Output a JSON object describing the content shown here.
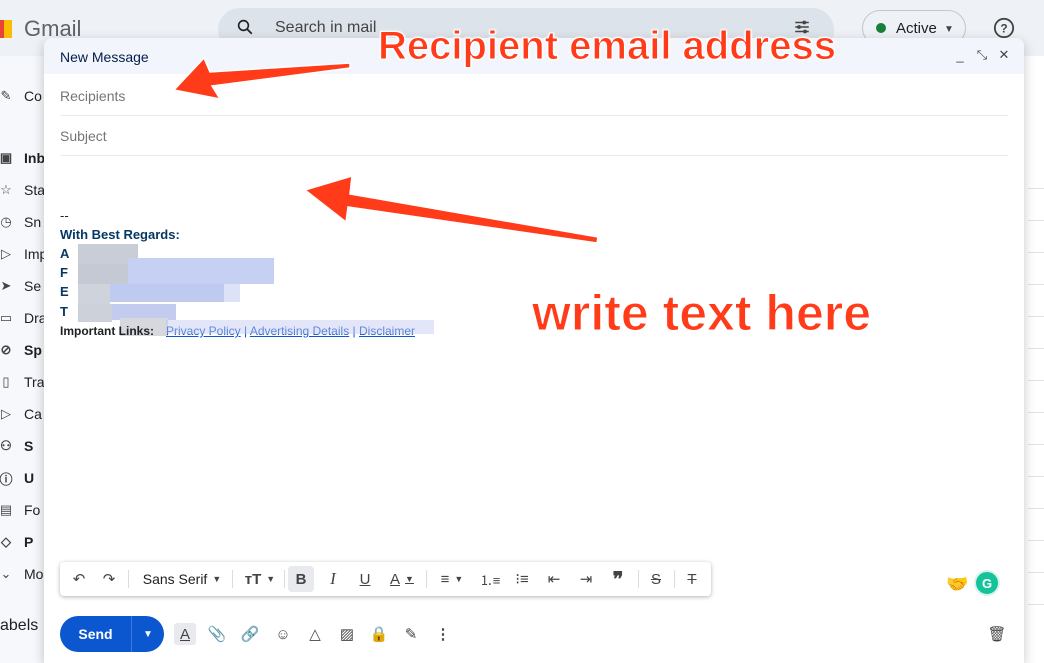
{
  "app": {
    "logo_text": "Gmail",
    "search_placeholder": "Search in mail",
    "status_label": "Active",
    "labels_heading": "abels"
  },
  "sidebar": {
    "items": [
      {
        "label": "Co",
        "icon": "pencil-icon"
      },
      {
        "label": "Inb",
        "icon": "inbox-icon"
      },
      {
        "label": "Sta",
        "icon": "star-icon"
      },
      {
        "label": "Sn",
        "icon": "clock-icon"
      },
      {
        "label": "Imp",
        "icon": "label-icon"
      },
      {
        "label": "Se",
        "icon": "send-icon"
      },
      {
        "label": "Dra",
        "icon": "draft-icon"
      },
      {
        "label": "Sp",
        "icon": "spam-icon"
      },
      {
        "label": "Tra",
        "icon": "trash-icon"
      },
      {
        "label": "Ca",
        "icon": "category-icon"
      },
      {
        "label": "S",
        "icon": "people-icon"
      },
      {
        "label": "U",
        "icon": "info-icon"
      },
      {
        "label": "Fo",
        "icon": "forum-icon"
      },
      {
        "label": "P",
        "icon": "tag-icon"
      },
      {
        "label": "Mo",
        "icon": "chevron-down-icon"
      }
    ]
  },
  "compose": {
    "title": "New Message",
    "recipients_placeholder": "Recipients",
    "subject_placeholder": "Subject",
    "signature": {
      "dash": "--",
      "regards": "With Best Regards:",
      "line_initials": [
        "A",
        "F",
        "E",
        "T"
      ],
      "important_label": "Important Links:",
      "links": [
        "Privacy Policy",
        "Advertising Details",
        "Disclaimer"
      ],
      "link_separator": " | "
    },
    "toolbar": {
      "font": "Sans Serif"
    },
    "send_label": "Send"
  },
  "annotations": {
    "recipient": "Recipient email address",
    "body": "write text here",
    "color": "#ff3b1a"
  },
  "colors": {
    "send_button": "#0b57d0",
    "signature_text": "#073763",
    "link": "#1155cc"
  }
}
